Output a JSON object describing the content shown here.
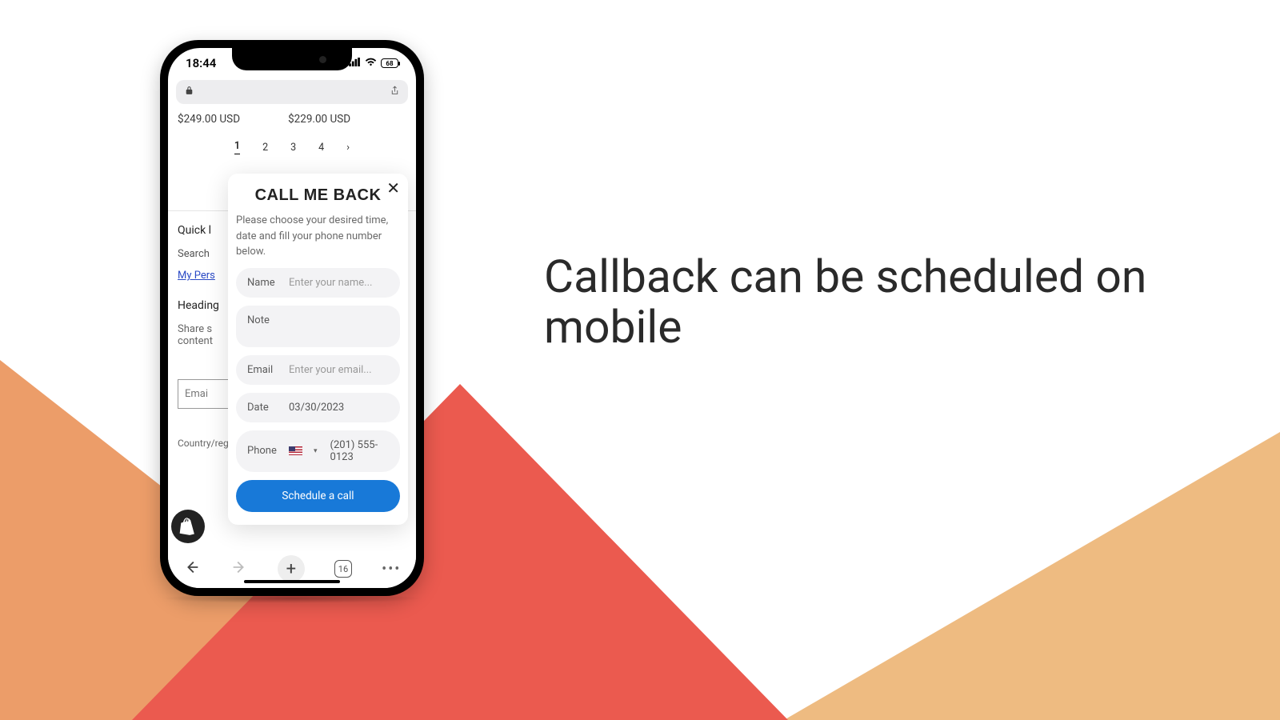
{
  "headline": "Callback can be scheduled on mobile",
  "status": {
    "time": "18:44",
    "battery": "68"
  },
  "prices": {
    "left": "$249.00 USD",
    "right": "$229.00 USD"
  },
  "pager": {
    "p1": "1",
    "p2": "2",
    "p3": "3",
    "p4": "4"
  },
  "footer": {
    "quick": "Quick l",
    "search": "Search",
    "mypers": "My Pers",
    "heading": "Heading",
    "share1": "Share s",
    "share2": "content",
    "email": "Emai",
    "country": "Country/region"
  },
  "popup": {
    "title": "CALL ME BACK",
    "desc": "Please choose your desired time, date and fill your phone number below.",
    "name_lbl": "Name",
    "name_ph": "Enter your name...",
    "note_lbl": "Note",
    "email_lbl": "Email",
    "email_ph": "Enter your email...",
    "date_lbl": "Date",
    "date_val": "03/30/2023",
    "phone_lbl": "Phone",
    "phone_ph": "(201) 555-0123",
    "cta": "Schedule a call"
  },
  "nav": {
    "tabs": "16"
  }
}
